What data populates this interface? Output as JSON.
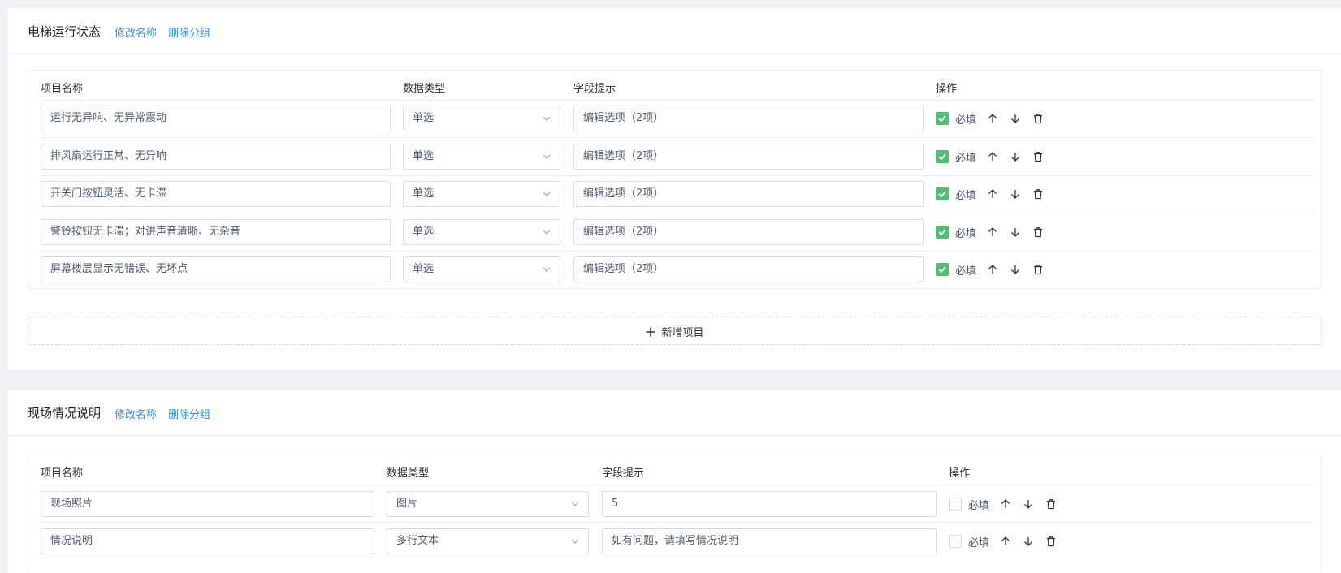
{
  "groups": [
    {
      "title": "电梯运行状态",
      "rename_label": "修改名称",
      "delete_label": "删除分组",
      "headers": {
        "name": "项目名称",
        "type": "数据类型",
        "hint": "字段提示",
        "ops": "操作"
      },
      "rows": [
        {
          "name": "运行无异响、无异常震动",
          "type": "单选",
          "hint": "编辑选项（2项）",
          "required": true,
          "required_label": "必填"
        },
        {
          "name": "排风扇运行正常、无异响",
          "type": "单选",
          "hint": "编辑选项（2项）",
          "required": true,
          "required_label": "必填"
        },
        {
          "name": "开关门按钮灵活、无卡滞",
          "type": "单选",
          "hint": "编辑选项（2项）",
          "required": true,
          "required_label": "必填"
        },
        {
          "name": "警铃按钮无卡滞；对讲声音清晰、无杂音",
          "type": "单选",
          "hint": "编辑选项（2项）",
          "required": true,
          "required_label": "必填"
        },
        {
          "name": "屏幕楼层显示无错误、无坏点",
          "type": "单选",
          "hint": "编辑选项（2项）",
          "required": true,
          "required_label": "必填"
        }
      ],
      "add_label": "新增项目"
    },
    {
      "title": "现场情况说明",
      "rename_label": "修改名称",
      "delete_label": "删除分组",
      "headers": {
        "name": "项目名称",
        "type": "数据类型",
        "hint": "字段提示",
        "ops": "操作"
      },
      "rows": [
        {
          "name": "现场照片",
          "type": "图片",
          "hint": "5",
          "required": false,
          "required_label": "必填"
        },
        {
          "name": "情况说明",
          "type": "多行文本",
          "hint": "如有问题，请填写情况说明",
          "required": false,
          "required_label": "必填"
        }
      ]
    }
  ],
  "icons": {
    "up": "arrow-up-icon",
    "down": "arrow-down-icon",
    "delete": "trash-icon",
    "add": "plus-icon",
    "select": "chevron-down-icon",
    "checked": "check-icon"
  },
  "colors": {
    "link": "#2d8cf0",
    "checkbox": "#4cc074",
    "background": "#eff1f5"
  }
}
